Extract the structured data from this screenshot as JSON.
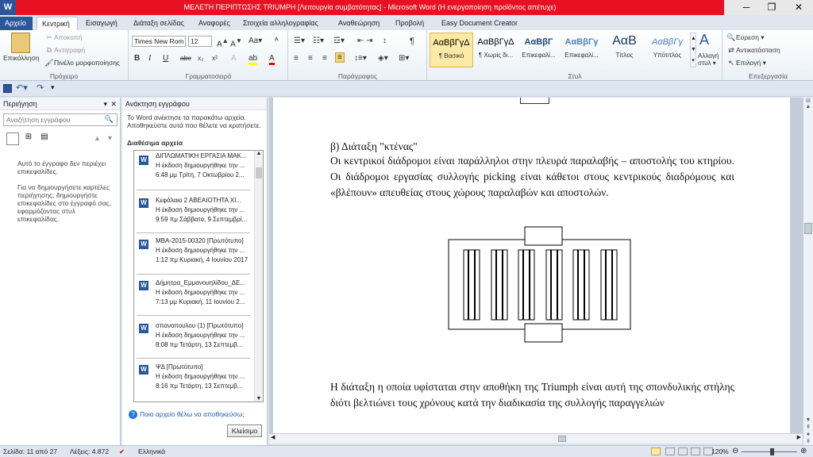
{
  "window": {
    "app_letter": "W",
    "title": "ΜΕΛΕΤΗ ΠΕΡΙΠΤΩΣΗΣ TRIUMPH [Λειτουργία συμβατότητας] - Microsoft Word (Η ενεργοποίηση προϊόντος απέτυχε)",
    "min": "─",
    "max": "❐",
    "close": "✕"
  },
  "tabs": [
    "Αρχείο",
    "Κεντρική",
    "Εισαγωγή",
    "Διάταξη σελίδας",
    "Αναφορές",
    "Στοιχεία αλληλογραφίας",
    "Αναθεώρηση",
    "Προβολή",
    "Easy Document Creator"
  ],
  "ribbon": {
    "clipboard": {
      "paste": "Επικόλληση",
      "cut": "Αποκοπή",
      "copy": "Αντιγραφή",
      "painter": "Πινέλο μορφοποίησης",
      "label": "Πρόχειρο"
    },
    "font": {
      "name": "Times New Rom",
      "size": "12",
      "label": "Γραμματοσειρά"
    },
    "paragraph": {
      "label": "Παράγραφος"
    },
    "styles": {
      "label": "Στυλ",
      "items": [
        {
          "sample": "ΑαΒβΓγΔ",
          "name": "¶ Βασικό"
        },
        {
          "sample": "ΑαΒβΓγΔ",
          "name": "¶ Χωρίς δι..."
        },
        {
          "sample": "ΑαΒβΓ",
          "name": "Επικεφαλί..."
        },
        {
          "sample": "ΑαΒβΓγ",
          "name": "Επικεφαλί..."
        },
        {
          "sample": "ΑαΒ",
          "name": "Τίτλος"
        },
        {
          "sample": "ΑαΒβΓγ",
          "name": "Υπότιτλος"
        }
      ],
      "change": "Αλλαγή στυλ ▾"
    },
    "editing": {
      "find": "Εύρεση ▾",
      "replace": "Αντικατάσταση",
      "select": "Επιλογή ▾",
      "label": "Επεξεργασία"
    }
  },
  "nav": {
    "title": "Περιήγηση",
    "search_placeholder": "Αναζήτηση εγγράφου",
    "msg1": "Αυτό το έγγραφο δεν περιέχει επικεφαλίδες.",
    "msg2": "Για να δημιουργήσετε καρτέλες περιήγησης, δημιουργήστε επικεφαλίδες στο έγγραφό σας, εφαρμόζοντας στυλ επικεφαλίδας."
  },
  "recovery": {
    "title": "Ανάκτηση εγγράφου",
    "intro": "Το Word ανέκτησε τα παρακάτω αρχεία. Αποθηκεύστε αυτά που θέλετε να κρατήσετε.",
    "available": "Διαθέσιμα αρχεία",
    "help": "Ποιο αρχείο θέλω να αποθηκεύσω;",
    "close": "Κλείσιμο",
    "files": [
      {
        "name": "ΔΙΠΛΩΜΑΤΙΚΗ ΕΡΓΑΣΙΑ ΜΑΚ...",
        "desc": "Η έκδοση δημιουργήθηκε την ...",
        "time": "6:48 μμ Τρίτη, 7 Οκτωβρίου 2..."
      },
      {
        "name": "Κεφάλαιο 2 ΑΒΕΑΙΟΤΗΤΑ ΧΙ...",
        "desc": "Η έκδοση δημιουργήθηκε την ...",
        "time": "9:59 πμ Σάββατο, 9 Σεπτεμβρί..."
      },
      {
        "name": "MBA-2015-00320  [Πρωτότυπο]",
        "desc": "Η έκδοση δημιουργήθηκε την ...",
        "time": "1:12 πμ Κυριακή, 4 Ιουνίου 2017"
      },
      {
        "name": "Δήμητρα_Εμμανουηλίδου_ΔΕ...",
        "desc": "Η έκδοση δημιουργήθηκε την ...",
        "time": "7:13 μμ Κυριακή, 11 Ιουνίου 2..."
      },
      {
        "name": "σπανοπουλου (1)  [Πρωτότυπο]",
        "desc": "Η έκδοση δημιουργήθηκε την ...",
        "time": "8:08 πμ Τετάρτη, 13 Σεπτεμβ..."
      },
      {
        "name": "ΨΔ  [Πρωτότυπο]",
        "desc": "Η έκδοση δημιουργήθηκε την ...",
        "time": "8:16 πμ Τετάρτη, 13 Σεπτεμβ..."
      }
    ]
  },
  "document": {
    "heading": "β) Διάταξη \"κτένας\"",
    "para1": "Οι κεντρικοί διάδρομοι είναι παράλληλοι στην πλευρά παραλαβής – αποστολής του κτηρίου. Οι διάδρομοι εργασίας συλλογής picking  είναι κάθετοι στους κεντρικούς διαδρόμους και «βλέπουν» απευθείας στους χώρους παραλαβών και αποστολών.",
    "para2": "Η διάταξη η οποία υφίσταται στην αποθήκη της Triumph είναι αυτή της σπονδυλικής στήλης διότι βελτιώνει τους χρόνους κατά την διαδικασία της συλλογής παραγγελιών"
  },
  "status": {
    "page": "Σελίδα: 11 από 27",
    "words": "Λέξεις: 4.872",
    "lang": "Ελληνικά",
    "zoom": "120%"
  }
}
